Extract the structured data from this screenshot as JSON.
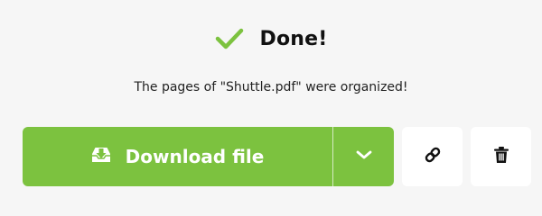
{
  "status": {
    "title": "Done!",
    "icon": "check-icon",
    "color": "#7cc23f"
  },
  "message": "The pages of \"Shuttle.pdf\" were organized!",
  "actions": {
    "download_label": "Download file",
    "download_icon": "download-tray-icon",
    "more_icon": "chevron-down-icon",
    "link_icon": "link-icon",
    "delete_icon": "trash-icon",
    "accent": "#7cc23f"
  }
}
